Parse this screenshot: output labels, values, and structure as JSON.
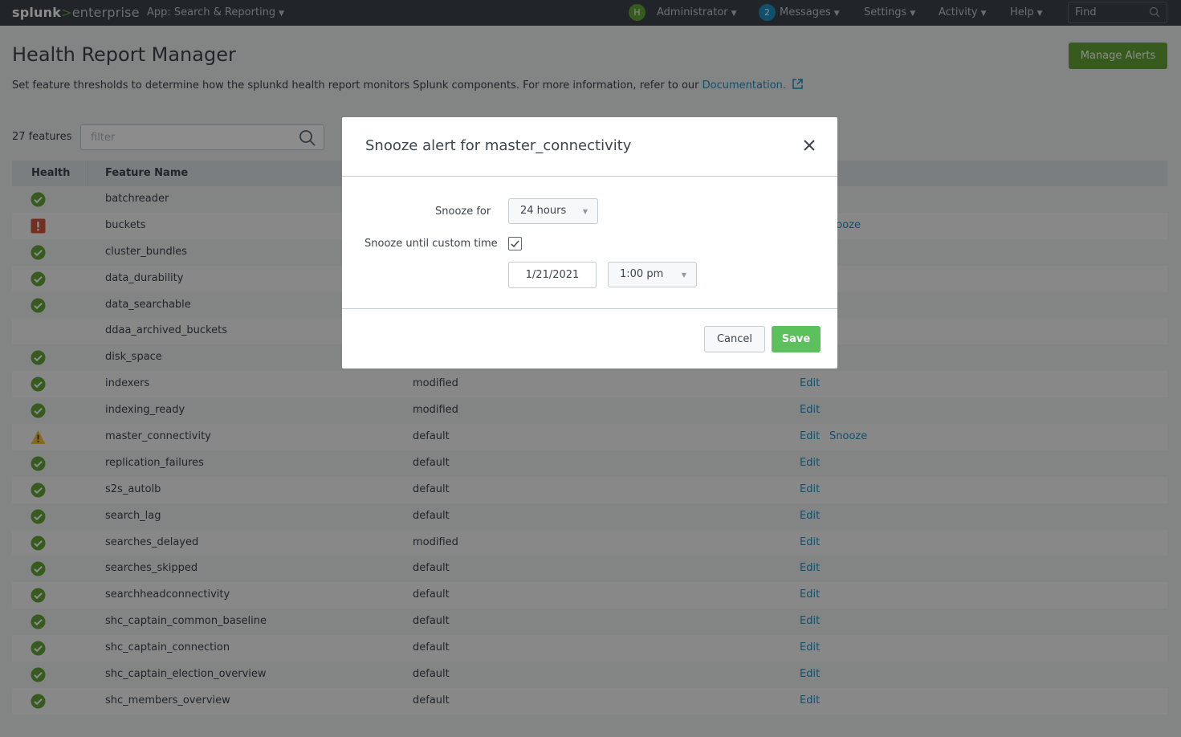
{
  "topbar": {
    "logo_splunk": "splunk",
    "logo_gt": ">",
    "logo_enterprise": "enterprise",
    "app_label": "App: Search & Reporting",
    "avatar_initial": "H",
    "user_label": "Administrator",
    "messages_count": "2",
    "messages_label": "Messages",
    "settings_label": "Settings",
    "activity_label": "Activity",
    "help_label": "Help",
    "find_placeholder": "Find"
  },
  "page": {
    "title": "Health Report Manager",
    "description": "Set feature thresholds to determine how the splunkd health report monitors Splunk components. For more information, refer to our",
    "doc_link": "Documentation.",
    "manage_alerts_label": "Manage Alerts",
    "feature_count": "27 features",
    "filter_placeholder": "filter"
  },
  "table": {
    "columns": [
      "Health",
      "Feature Name"
    ],
    "rows": [
      {
        "health": "green",
        "name": "batchreader",
        "settings": "",
        "edit": "",
        "snooze": ""
      },
      {
        "health": "red",
        "name": "buckets",
        "settings": "",
        "edit": "",
        "snooze": "nooze"
      },
      {
        "health": "green",
        "name": "cluster_bundles",
        "settings": "",
        "edit": "",
        "snooze": ""
      },
      {
        "health": "green",
        "name": "data_durability",
        "settings": "",
        "edit": "",
        "snooze": ""
      },
      {
        "health": "green",
        "name": "data_searchable",
        "settings": "",
        "edit": "",
        "snooze": ""
      },
      {
        "health": "none",
        "name": "ddaa_archived_buckets",
        "settings": "",
        "edit": "",
        "snooze": ""
      },
      {
        "health": "green",
        "name": "disk_space",
        "settings": "",
        "edit": "",
        "snooze": ""
      },
      {
        "health": "green",
        "name": "indexers",
        "settings": "modified",
        "edit": "Edit",
        "snooze": ""
      },
      {
        "health": "green",
        "name": "indexing_ready",
        "settings": "modified",
        "edit": "Edit",
        "snooze": ""
      },
      {
        "health": "yellow",
        "name": "master_connectivity",
        "settings": "default",
        "edit": "Edit",
        "snooze": "Snooze"
      },
      {
        "health": "green",
        "name": "replication_failures",
        "settings": "default",
        "edit": "Edit",
        "snooze": ""
      },
      {
        "health": "green",
        "name": "s2s_autolb",
        "settings": "default",
        "edit": "Edit",
        "snooze": ""
      },
      {
        "health": "green",
        "name": "search_lag",
        "settings": "default",
        "edit": "Edit",
        "snooze": ""
      },
      {
        "health": "green",
        "name": "searches_delayed",
        "settings": "modified",
        "edit": "Edit",
        "snooze": ""
      },
      {
        "health": "green",
        "name": "searches_skipped",
        "settings": "default",
        "edit": "Edit",
        "snooze": ""
      },
      {
        "health": "green",
        "name": "searchheadconnectivity",
        "settings": "default",
        "edit": "Edit",
        "snooze": ""
      },
      {
        "health": "green",
        "name": "shc_captain_common_baseline",
        "settings": "default",
        "edit": "Edit",
        "snooze": ""
      },
      {
        "health": "green",
        "name": "shc_captain_connection",
        "settings": "default",
        "edit": "Edit",
        "snooze": ""
      },
      {
        "health": "green",
        "name": "shc_captain_election_overview",
        "settings": "default",
        "edit": "Edit",
        "snooze": ""
      },
      {
        "health": "green",
        "name": "shc_members_overview",
        "settings": "default",
        "edit": "Edit",
        "snooze": ""
      }
    ]
  },
  "modal": {
    "title": "Snooze alert for master_connectivity",
    "snooze_for_label": "Snooze for",
    "snooze_for_value": "24 hours",
    "custom_time_label": "Snooze until custom time",
    "custom_time_checked": true,
    "date_value": "1/21/2021",
    "time_value": "1:00 pm",
    "cancel_label": "Cancel",
    "save_label": "Save"
  },
  "colors": {
    "topbar_bg": "#3c444d",
    "accent_green": "#65a637",
    "link_blue": "#1e93c6",
    "save_green": "#5cc05c",
    "status_green": "#65a637",
    "status_red": "#d6563c",
    "status_yellow": "#f8be34"
  }
}
